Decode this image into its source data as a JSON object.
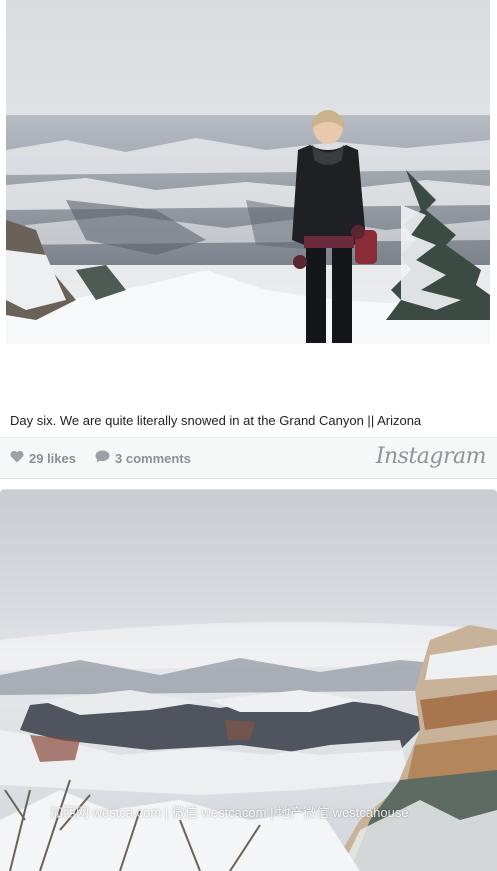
{
  "post1": {
    "caption": "Day six. We are quite literally snowed in at the Grand Canyon || Arizona",
    "likes_label": "29 likes",
    "comments_label": "3 comments",
    "brand": "Instagram",
    "icons": {
      "likes": "heart-icon",
      "comments": "speech-bubble-icon"
    }
  },
  "post2": {
    "watermark": "加西网 westca.com | 微信 westcacom | 地产微信 westcahouse"
  }
}
